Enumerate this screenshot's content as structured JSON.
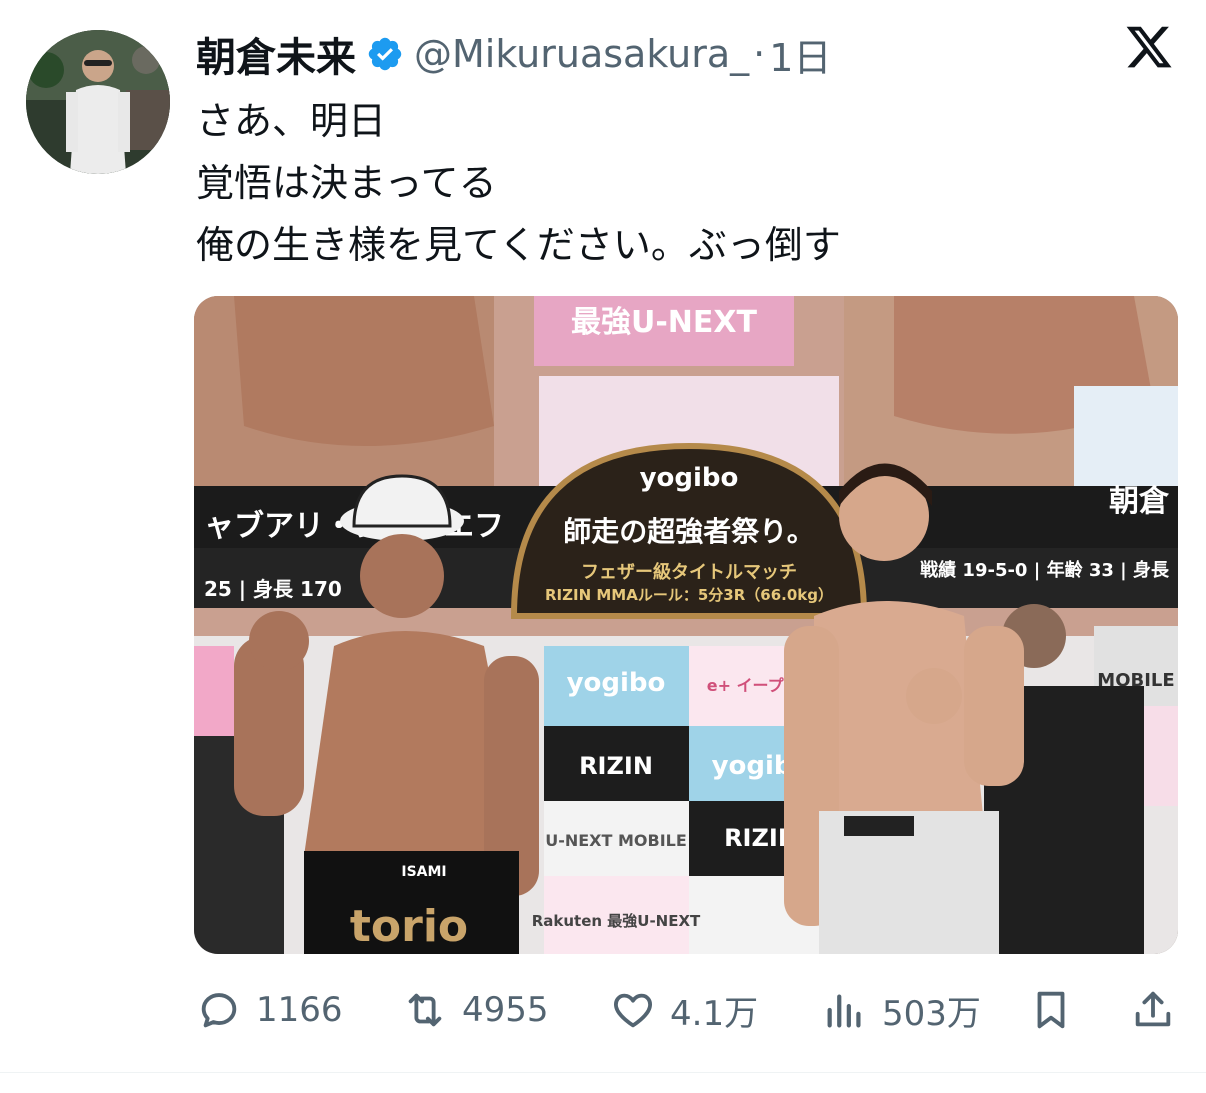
{
  "tweet": {
    "display_name": "朝倉未来",
    "handle": "@Mikuruasakura_",
    "separator": "·",
    "time": "1日",
    "lines": [
      "さあ、明日",
      "覚悟は決まってる",
      "俺の生き様を見てください。ぶっ倒す"
    ]
  },
  "media": {
    "banner_top": "最強U-NEXT",
    "event_brand": "yogibo",
    "event_title": "師走の超強者祭り。",
    "fighter_left_name": "ャブアリ・シェ…エフ",
    "fighter_right_name": "朝倉",
    "left_stats": "25 | 身長 170",
    "right_stats": "戦績 19-5-0 | 年齢 33 | 身長",
    "match_title": "フェザー級タイトルマッチ",
    "match_rule": "RIZIN MMAルール：5分3R（66.0kg）",
    "sponsor_yogibo": "yogibo",
    "sponsor_rizin": "RIZIN",
    "sponsor_eplus": "e+ イープラス",
    "sponsor_mobile": "U-NEXT MOBILE",
    "sponsor_rakuten": "Rakuten 最強U-NEXT",
    "shorts_brand": "torio",
    "shorts_waist": "ISAMI",
    "mobile_right": "MOBILE"
  },
  "actions": {
    "replies": "1166",
    "reposts": "4955",
    "likes": "4.1万",
    "views": "503万"
  },
  "colors": {
    "verified": "#1d9bf0",
    "secondary_text": "#536471",
    "primary_text": "#0f1419"
  },
  "icons": {
    "verified": "verified-badge-icon",
    "x_logo": "x-logo-icon",
    "reply": "reply-icon",
    "repost": "repost-icon",
    "like": "heart-icon",
    "views": "views-icon",
    "bookmark": "bookmark-icon",
    "share": "share-icon"
  }
}
